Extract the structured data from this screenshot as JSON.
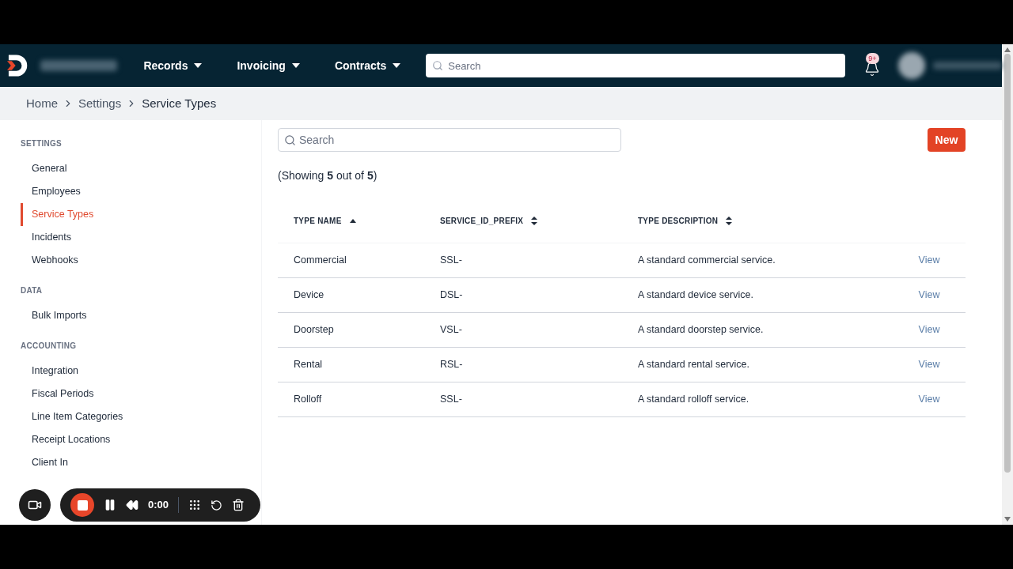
{
  "nav": {
    "menus": [
      {
        "label": "Records"
      },
      {
        "label": "Invoicing"
      },
      {
        "label": "Contracts"
      }
    ],
    "search": {
      "placeholder": "Search"
    },
    "notifications": {
      "badge": "9+"
    }
  },
  "breadcrumb": [
    "Home",
    "Settings",
    "Service Types"
  ],
  "sidebar": {
    "sections": [
      {
        "title": "SETTINGS",
        "items": [
          {
            "label": "General",
            "selected": false
          },
          {
            "label": "Employees",
            "selected": false
          },
          {
            "label": "Service Types",
            "selected": true
          },
          {
            "label": "Incidents",
            "selected": false
          },
          {
            "label": "Webhooks",
            "selected": false
          }
        ]
      },
      {
        "title": "DATA",
        "items": [
          {
            "label": "Bulk Imports",
            "selected": false
          }
        ]
      },
      {
        "title": "ACCOUNTING",
        "items": [
          {
            "label": "Integration",
            "selected": false
          },
          {
            "label": "Fiscal Periods",
            "selected": false
          },
          {
            "label": "Line Item Categories",
            "selected": false
          },
          {
            "label": "Receipt Locations",
            "selected": false
          },
          {
            "label": "Client In",
            "selected": false
          }
        ]
      }
    ]
  },
  "content": {
    "search": {
      "placeholder": "Search"
    },
    "new_button": "New",
    "summary": "(Showing **5** out of **5**)",
    "table": {
      "columns": [
        {
          "label": "TYPE NAME",
          "sorted": true
        },
        {
          "label": "SERVICE_ID_PREFIX",
          "sorted": false
        },
        {
          "label": "TYPE DESCRIPTION",
          "sorted": false
        }
      ],
      "rows": [
        {
          "cells": [
            "Commercial",
            "SSL-",
            "A standard commercial service."
          ],
          "action": "View"
        },
        {
          "cells": [
            "Device",
            "DSL-",
            "A standard device service."
          ],
          "action": "View"
        },
        {
          "cells": [
            "Doorstep",
            "VSL-",
            "A standard doorstep service."
          ],
          "action": "View"
        },
        {
          "cells": [
            "Rental",
            "RSL-",
            "A standard rental service."
          ],
          "action": "View"
        },
        {
          "cells": [
            "Rolloff",
            "SSL-",
            "A standard rolloff service."
          ],
          "action": "View"
        }
      ]
    }
  },
  "recorder": {
    "time": "0:00"
  }
}
